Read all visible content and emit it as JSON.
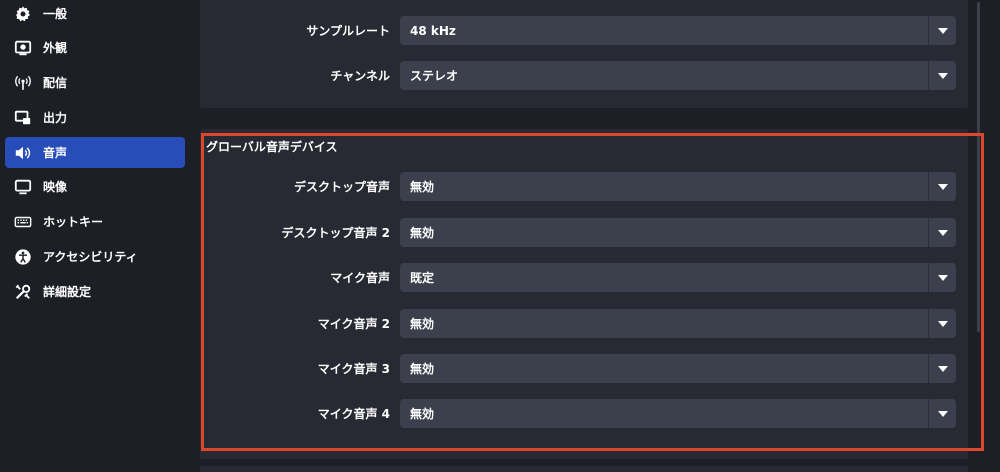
{
  "sidebar": {
    "items": [
      {
        "label": "一般",
        "icon": "gear-icon"
      },
      {
        "label": "外観",
        "icon": "appearance-icon"
      },
      {
        "label": "配信",
        "icon": "broadcast-icon"
      },
      {
        "label": "出力",
        "icon": "output-icon"
      },
      {
        "label": "音声",
        "icon": "speaker-icon",
        "active": true
      },
      {
        "label": "映像",
        "icon": "monitor-icon"
      },
      {
        "label": "ホットキー",
        "icon": "keyboard-icon"
      },
      {
        "label": "アクセシビリティ",
        "icon": "accessibility-icon"
      },
      {
        "label": "詳細設定",
        "icon": "tools-icon"
      }
    ]
  },
  "general": {
    "sample_rate": {
      "label": "サンプルレート",
      "value": "48 kHz"
    },
    "channels": {
      "label": "チャンネル",
      "value": "ステレオ"
    }
  },
  "global_devices": {
    "title": "グローバル音声デバイス",
    "rows": [
      {
        "label": "デスクトップ音声",
        "value": "無効"
      },
      {
        "label": "デスクトップ音声 2",
        "value": "無効"
      },
      {
        "label": "マイク音声",
        "value": "既定"
      },
      {
        "label": "マイク音声 2",
        "value": "無効"
      },
      {
        "label": "マイク音声 3",
        "value": "無効"
      },
      {
        "label": "マイク音声 4",
        "value": "無効"
      }
    ]
  },
  "colors": {
    "accent": "#284cb8",
    "highlight": "#e0452e",
    "panel": "#272a33",
    "select": "#3c404d"
  }
}
